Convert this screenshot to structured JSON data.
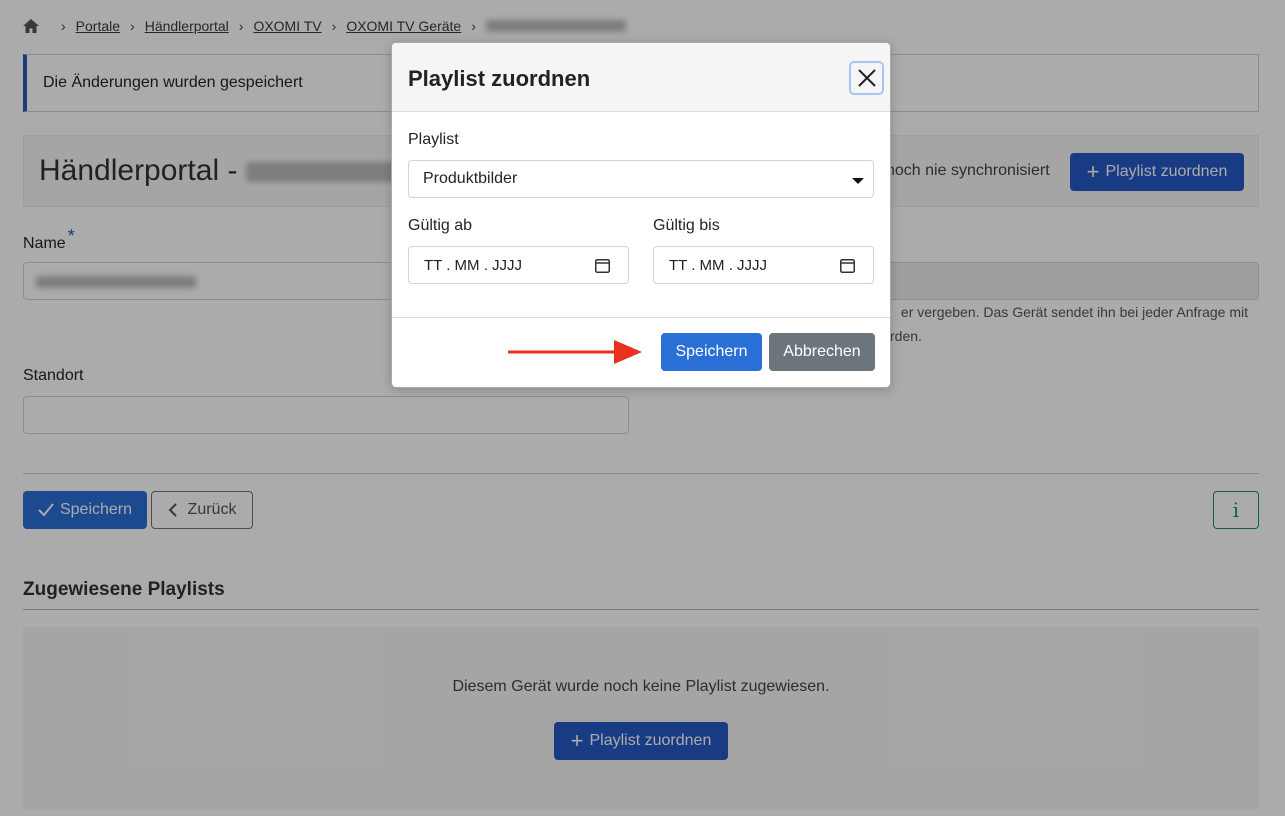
{
  "breadcrumb": {
    "items": [
      "Portale",
      "Händlerportal",
      "OXOMI TV",
      "OXOMI TV Geräte"
    ],
    "current": "",
    "separator": "›"
  },
  "alert": {
    "message": "Die Änderungen wurden gespeichert"
  },
  "header": {
    "title": "Händlerportal - ",
    "sync_status": "noch nie synchronisiert",
    "assign_button": "Playlist zuordnen"
  },
  "form": {
    "name_label": "Name",
    "required_mark": "*",
    "help_line1": "er vergeben. Das Gerät sendet ihn bei jeder Anfrage mit",
    "help_line2": "rden.",
    "location_label": "Standort",
    "location_value": ""
  },
  "actions": {
    "save": "Speichern",
    "back": "Zurück",
    "info": "i"
  },
  "playlists_section": {
    "title": "Zugewiesene Playlists",
    "empty_text": "Diesem Gerät wurde noch keine Playlist zugewiesen.",
    "assign_button": "Playlist zuordnen"
  },
  "modal": {
    "title": "Playlist zuordnen",
    "playlist_label": "Playlist",
    "playlist_selected": "Produktbilder",
    "valid_from_label": "Gültig ab",
    "valid_from_placeholder": "TT . MM . JJJJ",
    "valid_to_label": "Gültig bis",
    "valid_to_placeholder": "TT . MM . JJJJ",
    "save": "Speichern",
    "cancel": "Abbrechen"
  },
  "colors": {
    "primary": "#2a6fd6",
    "primary_dark": "#2458c5",
    "secondary": "#6c757d",
    "info": "#1f8a8a",
    "arrow": "#e8321e"
  },
  "icons": [
    "home-icon",
    "check-icon",
    "chevron-left-icon",
    "plus-icon",
    "close-icon",
    "calendar-icon",
    "caret-down-icon",
    "arrow-right-icon"
  ]
}
